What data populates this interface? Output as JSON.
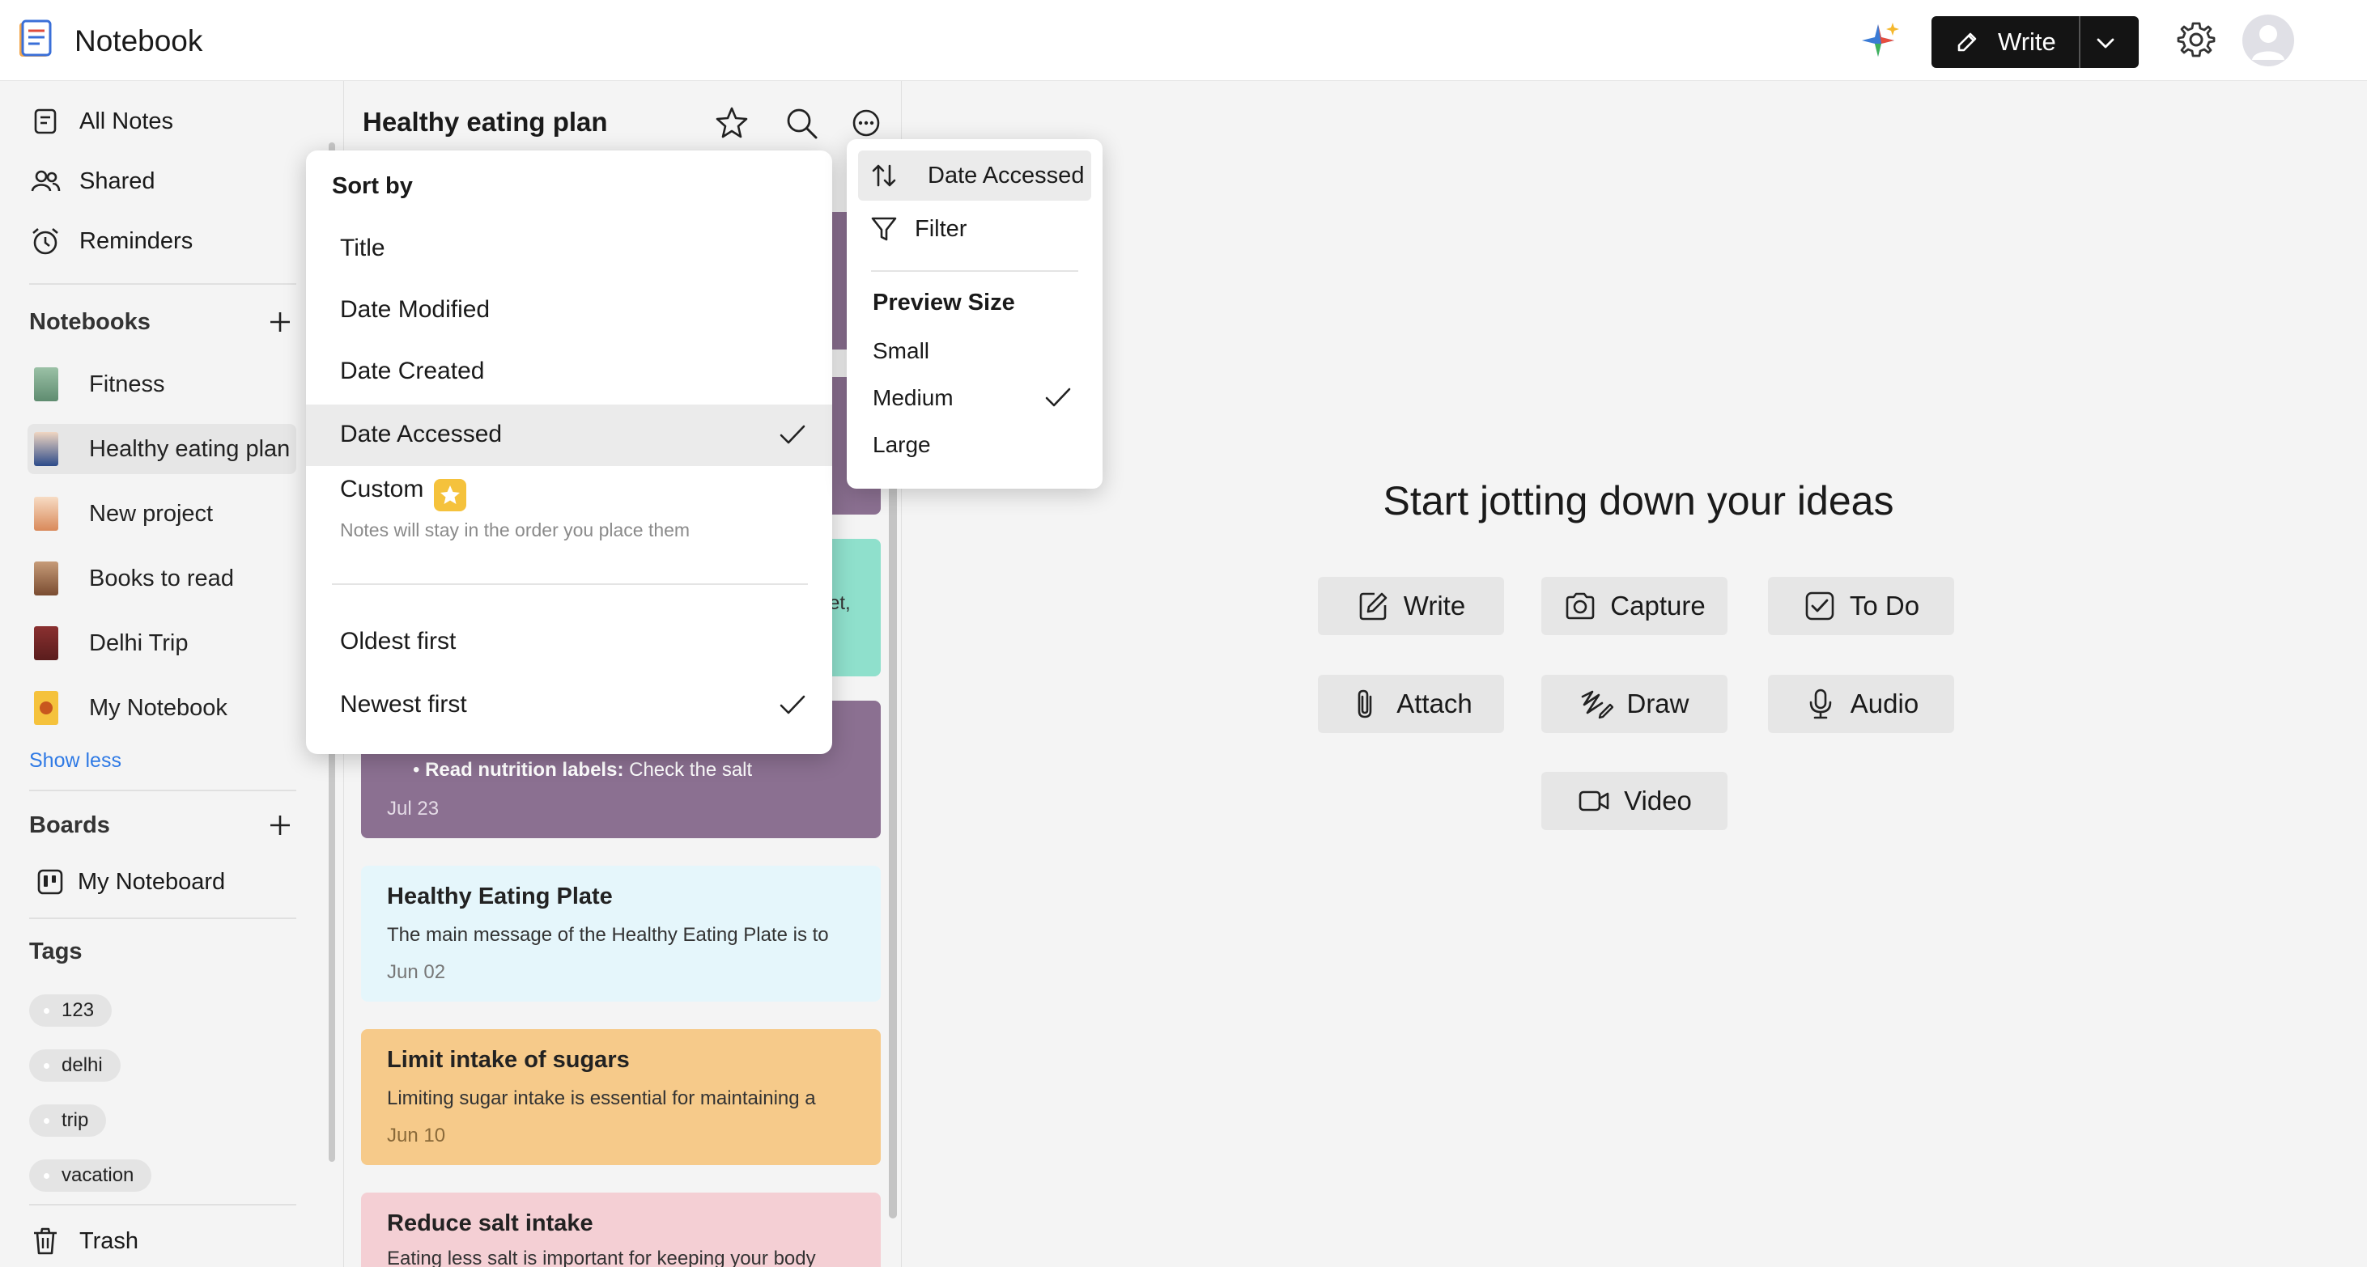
{
  "app": {
    "title": "Notebook"
  },
  "header": {
    "write_label": "Write"
  },
  "sidebar": {
    "nav": [
      {
        "label": "All Notes",
        "icon": "note-icon"
      },
      {
        "label": "Shared",
        "icon": "users-icon"
      },
      {
        "label": "Reminders",
        "icon": "alarm-icon"
      }
    ],
    "notebooks_title": "Notebooks",
    "notebooks": [
      {
        "label": "Fitness",
        "color": "#7fa98c"
      },
      {
        "label": "Healthy eating plan",
        "color": "#d96b4e",
        "active": true
      },
      {
        "label": "New project",
        "color": "#e8b08a"
      },
      {
        "label": "Books to read",
        "color": "#8a5a3c"
      },
      {
        "label": "Delhi Trip",
        "color": "#7a2c2c"
      },
      {
        "label": "My Notebook",
        "color": "#f2c53d"
      }
    ],
    "show_less": "Show less",
    "boards_title": "Boards",
    "boards": [
      {
        "label": "My Noteboard"
      }
    ],
    "tags_title": "Tags",
    "tags": [
      "123",
      "delhi",
      "trip",
      "vacation"
    ],
    "trash": "Trash"
  },
  "note_list": {
    "notebook_name": "Healthy eating plan",
    "cards": [
      {
        "title": "",
        "body": "",
        "date": "",
        "color": "#8b7091"
      },
      {
        "title": "",
        "body": "",
        "date": "",
        "color": "#8b7091"
      },
      {
        "title": "",
        "body": "et,",
        "date": "",
        "color": "#8fe0cc"
      },
      {
        "title": "",
        "body_bold": "Read nutrition labels:",
        "body": " Check the salt",
        "date": "Jul 23",
        "color": "#8b7091"
      },
      {
        "title": "Healthy Eating Plate",
        "body": "The main message of the Healthy Eating Plate is to",
        "date": "Jun 02",
        "color": "#e5f6fb"
      },
      {
        "title": "Limit intake of sugars",
        "body": "Limiting sugar intake is essential for maintaining a",
        "date": "Jun 10",
        "color": "#f6ca8a"
      },
      {
        "title": "Reduce salt intake",
        "body": "Eating less salt is important for keeping your body",
        "date": "",
        "color": "#f4cfd4"
      }
    ]
  },
  "sort_menu": {
    "title": "Sort by",
    "options": [
      "Title",
      "Date Modified",
      "Date Created",
      "Date Accessed"
    ],
    "selected": "Date Accessed",
    "custom_label": "Custom",
    "custom_sub": "Notes will stay in the order you place them",
    "order_options": [
      "Oldest first",
      "Newest first"
    ],
    "order_selected": "Newest first"
  },
  "options_menu": {
    "sort_label": "Date Accessed",
    "filter_label": "Filter",
    "preview_title": "Preview Size",
    "sizes": [
      "Small",
      "Medium",
      "Large"
    ],
    "size_selected": "Medium"
  },
  "main": {
    "headline": "Start jotting down your ideas",
    "actions": [
      {
        "label": "Write",
        "icon": "edit-icon"
      },
      {
        "label": "Capture",
        "icon": "camera-icon"
      },
      {
        "label": "To Do",
        "icon": "checkbox-icon"
      },
      {
        "label": "Attach",
        "icon": "paperclip-icon"
      },
      {
        "label": "Draw",
        "icon": "scribble-icon"
      },
      {
        "label": "Audio",
        "icon": "microphone-icon"
      },
      {
        "label": "Video",
        "icon": "video-icon"
      }
    ]
  }
}
